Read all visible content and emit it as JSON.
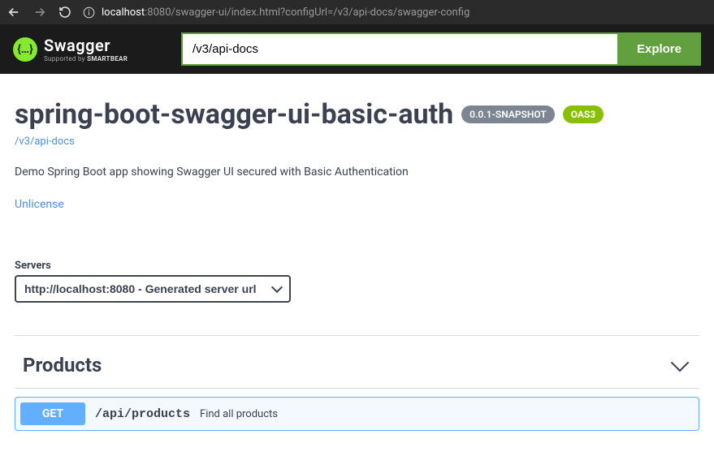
{
  "browser": {
    "url_host": "localhost",
    "url_rest": ":8080/swagger-ui/index.html?configUrl=/v3/api-docs/swagger-config"
  },
  "header": {
    "logo_main": "Swagger",
    "logo_sub_prefix": "Supported by ",
    "logo_sub_brand": "SMARTBEAR",
    "search_value": "/v3/api-docs",
    "explore_label": "Explore"
  },
  "info": {
    "title": "spring-boot-swagger-ui-basic-auth",
    "version": "0.0.1-SNAPSHOT",
    "oas": "OAS3",
    "docs_link": "/v3/api-docs",
    "description": "Demo Spring Boot app showing Swagger UI secured with Basic Authentication",
    "license": "Unlicense"
  },
  "servers": {
    "label": "Servers",
    "selected": "http://localhost:8080 - Generated server url"
  },
  "tag": {
    "name": "Products"
  },
  "operation": {
    "method": "GET",
    "path": "/api/products",
    "summary": "Find all products"
  }
}
